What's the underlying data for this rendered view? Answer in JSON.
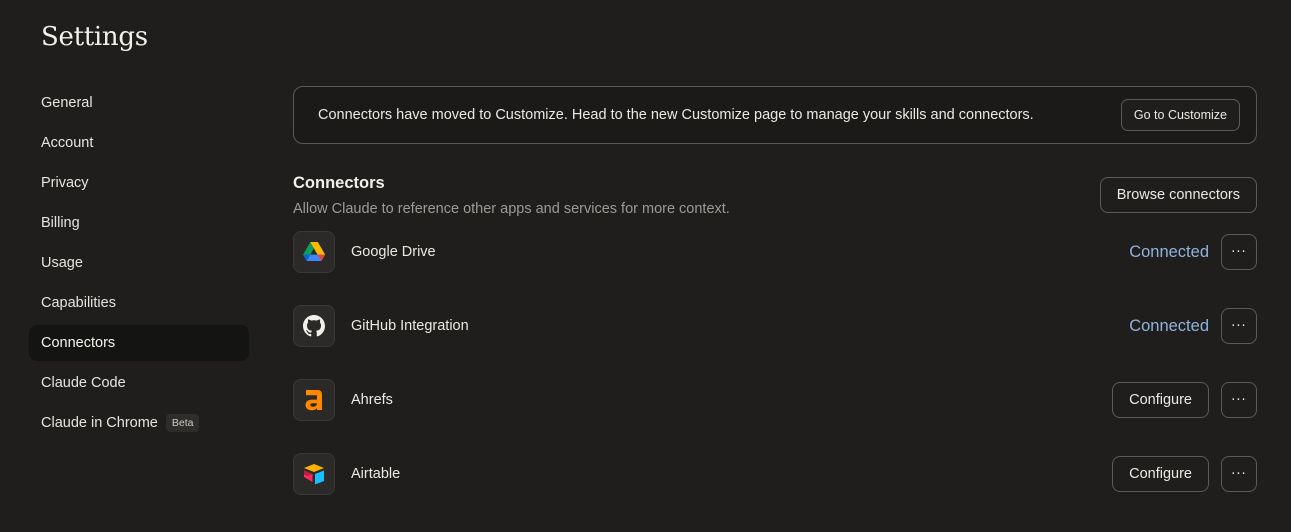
{
  "page": {
    "title": "Settings"
  },
  "sidebar": {
    "items": [
      {
        "label": "General"
      },
      {
        "label": "Account"
      },
      {
        "label": "Privacy"
      },
      {
        "label": "Billing"
      },
      {
        "label": "Usage"
      },
      {
        "label": "Capabilities"
      },
      {
        "label": "Connectors",
        "active": true
      },
      {
        "label": "Claude Code"
      },
      {
        "label": "Claude in Chrome",
        "badge": "Beta"
      }
    ]
  },
  "notice": {
    "text": "Connectors have moved to Customize. Head to the new Customize page to manage your skills and connectors.",
    "button_label": "Go to Customize"
  },
  "connectors": {
    "title": "Connectors",
    "subtitle": "Allow Claude to reference other apps and services for more context.",
    "browse_label": "Browse connectors",
    "more_label": "···",
    "items": [
      {
        "name": "Google Drive",
        "icon": "google-drive-icon",
        "status": "Connected"
      },
      {
        "name": "GitHub Integration",
        "icon": "github-icon",
        "status": "Connected"
      },
      {
        "name": "Ahrefs",
        "icon": "ahrefs-icon",
        "action": "Configure"
      },
      {
        "name": "Airtable",
        "icon": "airtable-icon",
        "action": "Configure"
      }
    ]
  },
  "colors": {
    "background": "#1f1e1d",
    "connected": "#8fb3dd",
    "ahrefs_orange": "#ff8800"
  }
}
